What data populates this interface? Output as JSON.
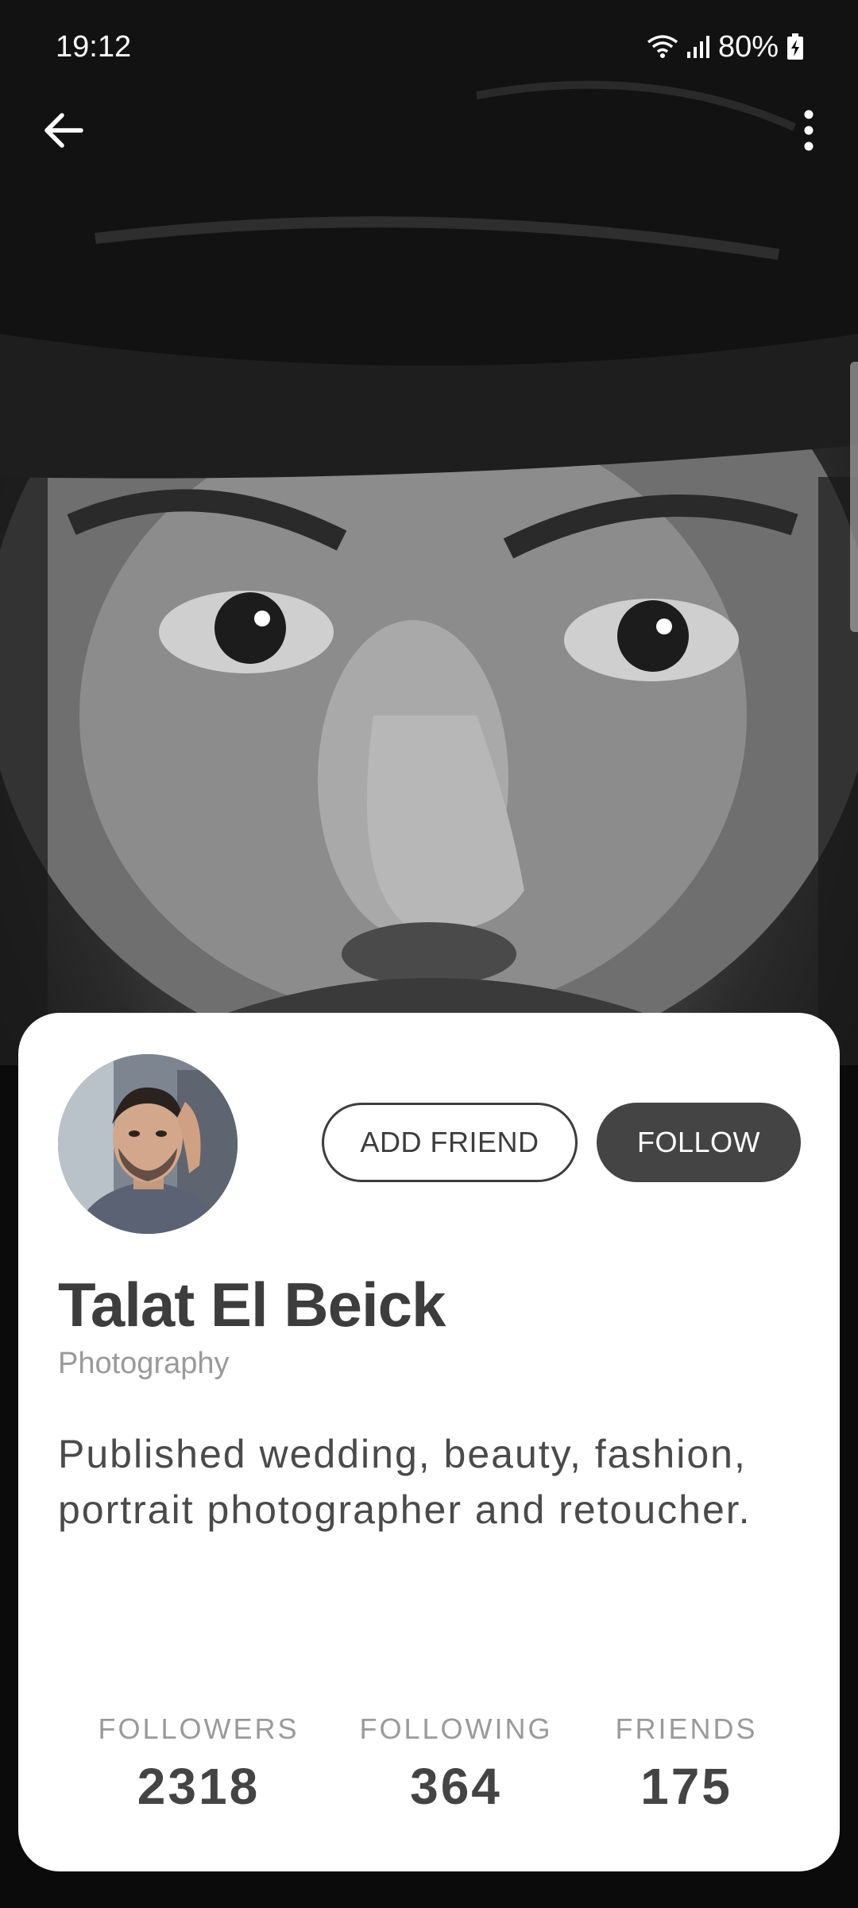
{
  "status_bar": {
    "time": "19:12",
    "battery_percent": "80%",
    "icons": [
      "wifi-icon",
      "signal-icon",
      "battery-charging-icon"
    ]
  },
  "app_bar": {
    "back_icon": "arrow-left-icon",
    "more_icon": "more-vertical-icon"
  },
  "cover": {
    "image": "black-and-white portrait photo"
  },
  "profile": {
    "name": "Talat El Beick",
    "category": "Photography",
    "bio": "Published wedding, beauty, fashion, portrait photographer and retoucher.",
    "buttons": {
      "add_friend": "ADD FRIEND",
      "follow": "FOLLOW"
    },
    "stats": [
      {
        "label": "FOLLOWERS",
        "value": "2318"
      },
      {
        "label": "FOLLOWING",
        "value": "364"
      },
      {
        "label": "FRIENDS",
        "value": "175"
      }
    ]
  },
  "colors": {
    "card_bg": "#ffffff",
    "primary_dark": "#444444",
    "text_dark": "#3d3d3d",
    "text_muted": "#9a9a9a"
  }
}
